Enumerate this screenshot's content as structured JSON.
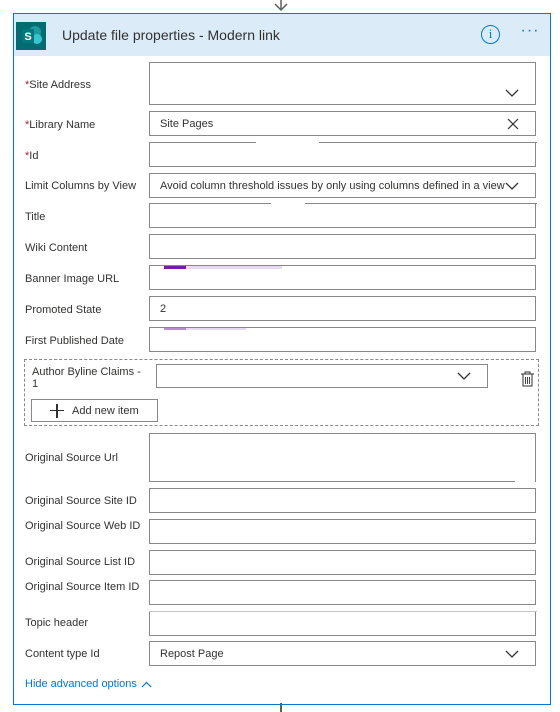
{
  "header": {
    "title": "Update file properties - Modern link",
    "info_label": "i",
    "more_label": "···"
  },
  "fields": {
    "site_address": {
      "label": "Site Address",
      "required": "*",
      "value": ""
    },
    "library_name": {
      "label": "Library Name",
      "required": "*",
      "value": "Site Pages"
    },
    "id": {
      "label": "Id",
      "required": "*",
      "value": ""
    },
    "limit_columns": {
      "label": "Limit Columns by View",
      "value": "Avoid column threshold issues by only using columns defined in a view"
    },
    "title": {
      "label": "Title",
      "value": ""
    },
    "wiki_content": {
      "label": "Wiki Content",
      "value": ""
    },
    "banner_image_url": {
      "label": "Banner Image URL",
      "value": ""
    },
    "promoted_state": {
      "label": "Promoted State",
      "value": "2"
    },
    "first_published_date": {
      "label": "First Published Date",
      "value": ""
    },
    "author_byline": {
      "label": "Author Byline Claims - 1",
      "value": ""
    },
    "original_source_url": {
      "label": "Original Source Url",
      "value": ""
    },
    "original_source_site_id": {
      "label": "Original Source Site ID",
      "value": ""
    },
    "original_source_web_id": {
      "label": "Original Source Web ID",
      "value": ""
    },
    "original_source_list_id": {
      "label": "Original Source List ID",
      "value": ""
    },
    "original_source_item_id": {
      "label": "Original Source Item ID",
      "value": ""
    },
    "topic_header": {
      "label": "Topic header",
      "value": ""
    },
    "content_type_id": {
      "label": "Content type Id",
      "value": "Repost Page"
    }
  },
  "add_new_item_label": "Add new item",
  "hide_advanced_label": "Hide advanced options",
  "colors": {
    "accent": "#0078d4",
    "header_bg": "#dcebf8",
    "required": "#a4262c",
    "token_purple": "#7719aa",
    "token_light": "#e8d9f3"
  }
}
